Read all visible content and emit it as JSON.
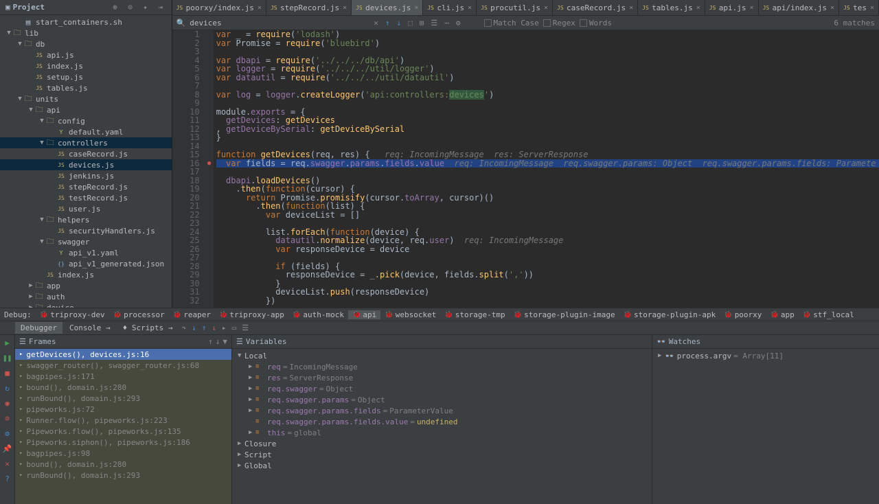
{
  "project": {
    "title": "Project",
    "tree": [
      {
        "d": 1,
        "a": "",
        "t": "file",
        "icon": "sh",
        "label": "start_containers.sh"
      },
      {
        "d": 0,
        "a": "▼",
        "t": "dir",
        "label": "lib"
      },
      {
        "d": 1,
        "a": "▼",
        "t": "dir",
        "label": "db"
      },
      {
        "d": 2,
        "a": "",
        "t": "js",
        "label": "api.js"
      },
      {
        "d": 2,
        "a": "",
        "t": "js",
        "label": "index.js"
      },
      {
        "d": 2,
        "a": "",
        "t": "js",
        "label": "setup.js"
      },
      {
        "d": 2,
        "a": "",
        "t": "js",
        "label": "tables.js"
      },
      {
        "d": 1,
        "a": "▼",
        "t": "dir",
        "label": "units"
      },
      {
        "d": 2,
        "a": "▼",
        "t": "dir",
        "label": "api"
      },
      {
        "d": 3,
        "a": "▼",
        "t": "dir",
        "label": "config"
      },
      {
        "d": 4,
        "a": "",
        "t": "yaml",
        "label": "default.yaml"
      },
      {
        "d": 3,
        "a": "▼",
        "t": "dir",
        "label": "controllers",
        "sel": true
      },
      {
        "d": 4,
        "a": "",
        "t": "js",
        "label": "caseRecord.js"
      },
      {
        "d": 4,
        "a": "",
        "t": "js",
        "label": "devices.js",
        "sel": true
      },
      {
        "d": 4,
        "a": "",
        "t": "js",
        "label": "jenkins.js"
      },
      {
        "d": 4,
        "a": "",
        "t": "js",
        "label": "stepRecord.js"
      },
      {
        "d": 4,
        "a": "",
        "t": "js",
        "label": "testRecord.js"
      },
      {
        "d": 4,
        "a": "",
        "t": "js",
        "label": "user.js"
      },
      {
        "d": 3,
        "a": "▼",
        "t": "dir",
        "label": "helpers"
      },
      {
        "d": 4,
        "a": "",
        "t": "js",
        "label": "securityHandlers.js"
      },
      {
        "d": 3,
        "a": "▼",
        "t": "dir",
        "label": "swagger"
      },
      {
        "d": 4,
        "a": "",
        "t": "yaml",
        "label": "api_v1.yaml"
      },
      {
        "d": 4,
        "a": "",
        "t": "json",
        "label": "api_v1_generated.json"
      },
      {
        "d": 3,
        "a": "",
        "t": "js",
        "label": "index.js"
      },
      {
        "d": 2,
        "a": "▶",
        "t": "dir",
        "label": "app"
      },
      {
        "d": 2,
        "a": "▶",
        "t": "dir",
        "label": "auth"
      },
      {
        "d": 2,
        "a": "▶",
        "t": "dir",
        "label": "device"
      }
    ]
  },
  "tabs": [
    {
      "label": "poorxy/index.js"
    },
    {
      "label": "stepRecord.js"
    },
    {
      "label": "devices.js",
      "active": true
    },
    {
      "label": "cli.js"
    },
    {
      "label": "procutil.js"
    },
    {
      "label": "caseRecord.js"
    },
    {
      "label": "tables.js"
    },
    {
      "label": "api.js"
    },
    {
      "label": "api/index.js"
    },
    {
      "label": "tes"
    }
  ],
  "search": {
    "value": "devices",
    "matchcase": "Match Case",
    "regex": "Regex",
    "words": "Words",
    "matches": "6 matches"
  },
  "code_lines": [
    {
      "n": 1,
      "html": "<span class='kw'>var</span> _ = <span class='fn'>require</span>(<span class='str'>'lodash'</span>)"
    },
    {
      "n": 2,
      "html": "<span class='kw'>var</span> Promise = <span class='fn'>require</span>(<span class='str'>'bluebird'</span>)"
    },
    {
      "n": 3,
      "html": ""
    },
    {
      "n": 4,
      "html": "<span class='kw'>var</span> <span class='ident'>dbapi</span> = <span class='fn'>require</span>(<span class='str'>'../../../db/api'</span>)"
    },
    {
      "n": 5,
      "html": "<span class='kw'>var</span> <span class='ident'>logger</span> = <span class='fn'>require</span>(<span class='str'>'../../../util/logger'</span>)"
    },
    {
      "n": 6,
      "html": "<span class='kw'>var</span> <span class='ident'>datautil</span> = <span class='fn'>require</span>(<span class='str'>'../../../util/datautil'</span>)"
    },
    {
      "n": 7,
      "html": ""
    },
    {
      "n": 8,
      "html": "<span class='kw'>var</span> <span class='ident'>log</span> = <span class='ident'>logger</span>.<span class='fn'>createLogger</span>(<span class='str'>'api:controllers:<span class='hl-search'>devices</span>'</span>)"
    },
    {
      "n": 9,
      "html": ""
    },
    {
      "n": 10,
      "html": "module.<span class='ident'>exports</span> = {"
    },
    {
      "n": 11,
      "html": "  <span class='ident'>getDevices</span>: <span class='fn'>getDevices</span>"
    },
    {
      "n": 12,
      "html": ", <span class='ident'>getDeviceBySerial</span>: <span class='fn'>getDeviceBySerial</span>"
    },
    {
      "n": 13,
      "html": "}"
    },
    {
      "n": 14,
      "html": ""
    },
    {
      "n": 15,
      "html": "<span class='kw'>function</span> <span class='fn'>getDevices</span>(req, res) {   <span class='param-hint'>req: IncomingMessage  res: ServerResponse</span>"
    },
    {
      "n": 16,
      "html": "  <span class='kw'>var</span> fields = req.<span class='ident'>swagger</span>.<span class='ident'>params</span>.<span class='ident'>fields</span>.<span class='ident'>value</span>  <span class='param-hint'>req: IncomingMessage  req.swagger.params: Object  req.swagger.params.fields: Paramete</span>",
      "hl": true,
      "bp": true
    },
    {
      "n": 17,
      "html": ""
    },
    {
      "n": 18,
      "html": "  <span class='ident'>dbapi</span>.<span class='fn'>loadDevices</span>()"
    },
    {
      "n": 19,
      "html": "    .<span class='fn'>then</span>(<span class='kw'>function</span>(cursor) {"
    },
    {
      "n": 20,
      "html": "      <span class='kw'>return</span> Promise.<span class='fn'>promisify</span>(cursor.<span class='ident'>toArray</span>, cursor)()"
    },
    {
      "n": 21,
      "html": "        .<span class='fn'>then</span>(<span class='kw'>function</span>(list) {"
    },
    {
      "n": 22,
      "html": "          <span class='kw'>var</span> deviceList = []"
    },
    {
      "n": 23,
      "html": ""
    },
    {
      "n": 24,
      "html": "          list.<span class='fn'>forEach</span>(<span class='kw'>function</span>(device) {"
    },
    {
      "n": 25,
      "html": "            <span class='ident'>datautil</span>.<span class='fn'>normalize</span>(device, req.<span class='ident'>user</span>)  <span class='param-hint'>req: IncomingMessage</span>"
    },
    {
      "n": 26,
      "html": "            <span class='kw'>var</span> responseDevice = device"
    },
    {
      "n": 27,
      "html": ""
    },
    {
      "n": 28,
      "html": "            <span class='kw'>if</span> (fields) {"
    },
    {
      "n": 29,
      "html": "              responseDevice = _.<span class='fn'>pick</span>(device, fields.<span class='fn'>split</span>(<span class='str'>','</span>))"
    },
    {
      "n": 30,
      "html": "            }"
    },
    {
      "n": 31,
      "html": "            deviceList.<span class='fn'>push</span>(responseDevice)"
    },
    {
      "n": 32,
      "html": "          })"
    }
  ],
  "debug": {
    "label": "Debug:",
    "configs": [
      {
        "l": "triproxy-dev"
      },
      {
        "l": "processor"
      },
      {
        "l": "reaper"
      },
      {
        "l": "triproxy-app"
      },
      {
        "l": "auth-mock"
      },
      {
        "l": "api",
        "active": true
      },
      {
        "l": "websocket"
      },
      {
        "l": "storage-tmp"
      },
      {
        "l": "storage-plugin-image"
      },
      {
        "l": "storage-plugin-apk"
      },
      {
        "l": "poorxy"
      },
      {
        "l": "app"
      },
      {
        "l": "stf_local"
      }
    ],
    "tabs": {
      "debugger": "Debugger",
      "console": "Console",
      "scripts": "Scripts"
    },
    "frames_title": "Frames",
    "frames": [
      {
        "l": "getDevices(), devices.js:16",
        "sel": true
      },
      {
        "l": "swagger_router(), swagger_router.js:68"
      },
      {
        "l": "bagpipes.js:171"
      },
      {
        "l": "bound(), domain.js:280"
      },
      {
        "l": "runBound(), domain.js:293"
      },
      {
        "l": "pipeworks.js:72"
      },
      {
        "l": "Runner.flow(), pipeworks.js:223"
      },
      {
        "l": "Pipeworks.flow(), pipeworks.js:135"
      },
      {
        "l": "Pipeworks.siphon(), pipeworks.js:186"
      },
      {
        "l": "bagpipes.js:98"
      },
      {
        "l": "bound(), domain.js:280"
      },
      {
        "l": "runBound(), domain.js:293"
      }
    ],
    "vars_title": "Variables",
    "vars": [
      {
        "d": 0,
        "a": "▼",
        "n": "Local",
        "plain": true
      },
      {
        "d": 1,
        "a": "▶",
        "n": "req",
        "v": "IncomingMessage"
      },
      {
        "d": 1,
        "a": "▶",
        "n": "res",
        "v": "ServerResponse"
      },
      {
        "d": 1,
        "a": "▶",
        "n": "req.swagger",
        "v": "Object"
      },
      {
        "d": 1,
        "a": "▶",
        "n": "req.swagger.params",
        "v": "Object"
      },
      {
        "d": 1,
        "a": "▶",
        "n": "req.swagger.params.fields",
        "v": "ParameterValue"
      },
      {
        "d": 1,
        "a": "",
        "n": "req.swagger.params.fields.value",
        "v": "undefined",
        "undef": true
      },
      {
        "d": 1,
        "a": "▶",
        "n": "this",
        "v": "global"
      },
      {
        "d": 0,
        "a": "▶",
        "n": "Closure",
        "plain": true
      },
      {
        "d": 0,
        "a": "▶",
        "n": "Script",
        "plain": true
      },
      {
        "d": 0,
        "a": "▶",
        "n": "Global",
        "plain": true
      }
    ],
    "watches_title": "Watches",
    "watches": [
      {
        "n": "process.argv",
        "v": "= Array[11]"
      }
    ]
  }
}
